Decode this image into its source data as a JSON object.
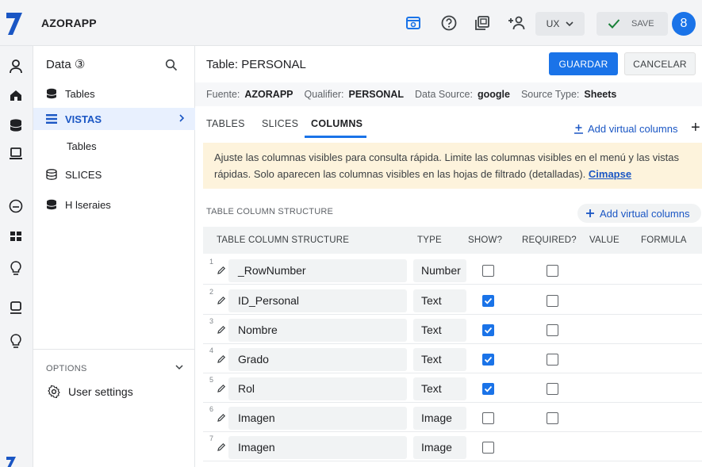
{
  "app": {
    "name": "AZORAPP"
  },
  "topbar": {
    "ux_label": "UX",
    "save_label": "SAVE",
    "badge_count": "8",
    "accent": "#1a73e8"
  },
  "sidebar": {
    "title": "Data",
    "count": "③",
    "items": [
      {
        "label": "Tables",
        "icon": "database-icon"
      },
      {
        "label": "VISTAS",
        "icon": "menu-icon"
      },
      {
        "label": "SLICES",
        "icon": "database-outline-icon"
      },
      {
        "label": "H lseraies",
        "icon": "database-icon"
      }
    ],
    "sub_item": "Tables",
    "options_label": "OPTIONS",
    "user_settings": "User settings"
  },
  "main": {
    "title": "Table: PERSONAL",
    "guardar": "GUARDAR",
    "cancelar": "CANCELAR",
    "meta": {
      "fuente_label": "Fuente:",
      "fuente": "AZORAPP",
      "qualifier_label": "Qualifier:",
      "qualifier": "PERSONAL",
      "datasource_label": "Data Source:",
      "datasource": "google",
      "sourcetype_label": "Source Type:",
      "sourcetype": "Sheets"
    },
    "tabs": [
      "TABLES",
      "SLICES",
      "COLUMNS"
    ],
    "add_virtual_columns_top": "Add virtual columns",
    "info_text": "Ajuste las columnas visibles para consulta rápida. Limite las columnas visibles en el menú y las vistas rápidas. Solo aparecen las columnas visibles en las hojas de filtrado (detalladas).",
    "info_link": "Cimapse",
    "structure_label": "TABLE COLUMN STRUCTURE",
    "add_virtual_columns": "Add virtual columns",
    "columns": [
      "TABLE COLUMN STRUCTURE",
      "TYPE",
      "SHOW?",
      "REQUIRED?",
      "VALUE",
      "FORMULA"
    ],
    "rows": [
      {
        "num": "1",
        "name": "_RowNumber",
        "type": "Number",
        "show": false,
        "required": false
      },
      {
        "num": "2",
        "name": "ID_Personal",
        "type": "Text",
        "show": true,
        "required": false
      },
      {
        "num": "3",
        "name": "Nombre",
        "type": "Text",
        "show": true,
        "required": false
      },
      {
        "num": "4",
        "name": "Grado",
        "type": "Text",
        "show": true,
        "required": false
      },
      {
        "num": "5",
        "name": "Rol",
        "type": "Text",
        "show": true,
        "required": false
      },
      {
        "num": "6",
        "name": "Imagen",
        "type": "Image",
        "show": false,
        "required": false
      },
      {
        "num": "7",
        "name": "Imagen",
        "type": "Image",
        "show": false,
        "required": null
      }
    ]
  }
}
